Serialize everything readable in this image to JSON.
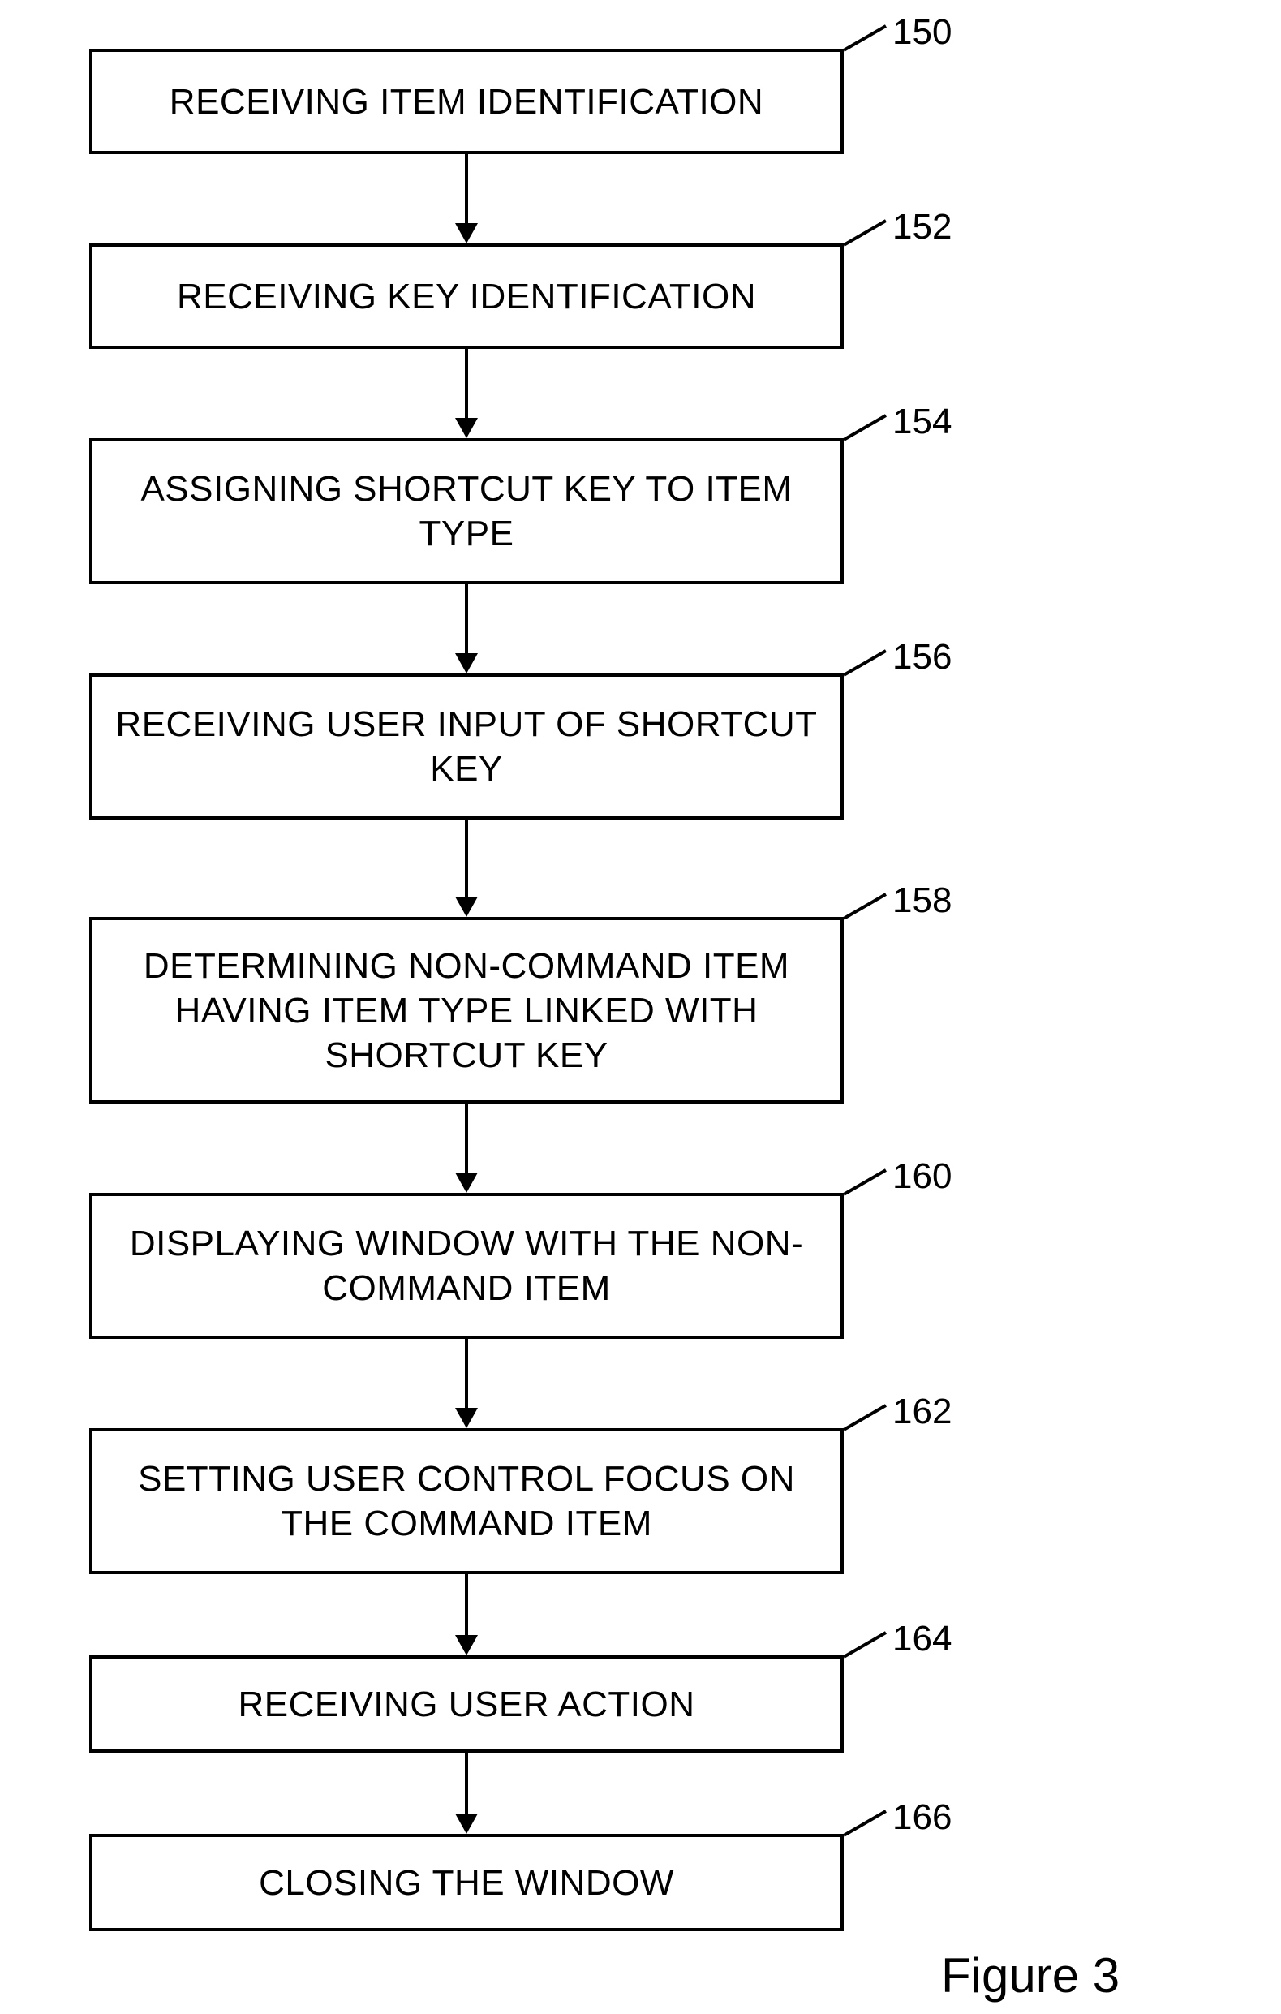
{
  "figure_caption": "Figure 3",
  "steps": [
    {
      "ref": "150",
      "text": "RECEIVING ITEM IDENTIFICATION"
    },
    {
      "ref": "152",
      "text": "RECEIVING KEY IDENTIFICATION"
    },
    {
      "ref": "154",
      "text": "ASSIGNING SHORTCUT KEY TO ITEM TYPE"
    },
    {
      "ref": "156",
      "text": "RECEIVING USER INPUT OF SHORTCUT KEY"
    },
    {
      "ref": "158",
      "text": "DETERMINING NON-COMMAND ITEM HAVING ITEM TYPE LINKED WITH SHORTCUT KEY"
    },
    {
      "ref": "160",
      "text": "DISPLAYING WINDOW WITH THE NON-COMMAND ITEM"
    },
    {
      "ref": "162",
      "text": "SETTING USER CONTROL FOCUS ON THE COMMAND ITEM"
    },
    {
      "ref": "164",
      "text": "RECEIVING USER ACTION"
    },
    {
      "ref": "166",
      "text": "CLOSING THE WINDOW"
    }
  ]
}
